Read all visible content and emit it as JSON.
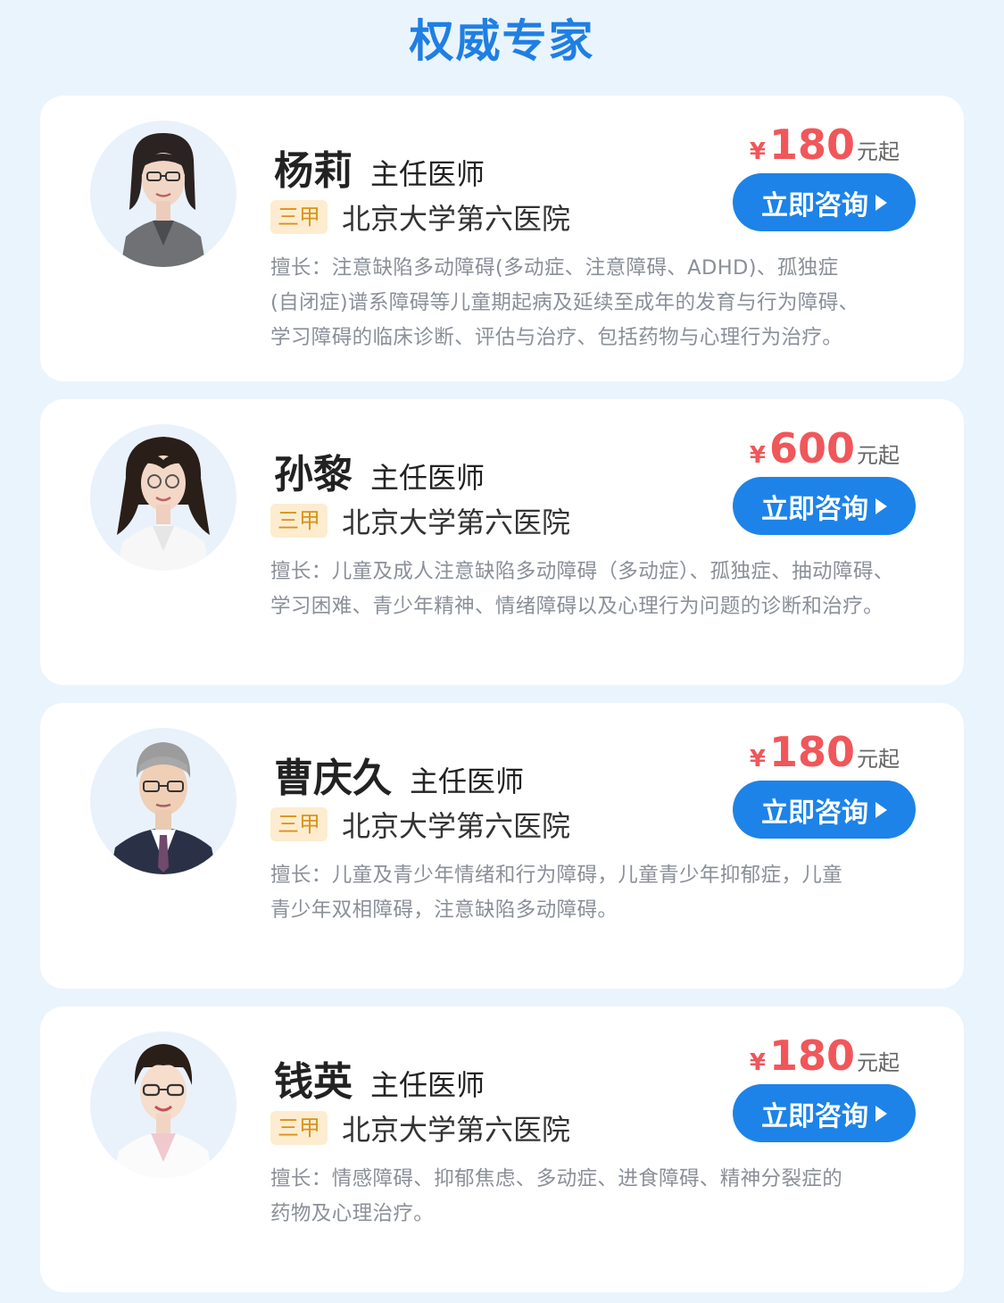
{
  "page_title": "权威专家",
  "experts": [
    {
      "name": "杨莉",
      "title": "主任医师",
      "badge": "三甲",
      "hospital": "北京大学第六医院",
      "price_currency": "¥",
      "price_value": "180",
      "price_suffix": "元起",
      "button_label": "立即咨询",
      "desc_lines": [
        "擅长：注意缺陷多动障碍(多动症、注意障碍、ADHD)、孤独症",
        "(自闭症)谱系障碍等儿童期起病及延续至成年的发育与行为障碍、",
        "学习障碍的临床诊断、评估与治疗、包括药物与心理行为治疗。"
      ]
    },
    {
      "name": "孙黎",
      "title": "主任医师",
      "badge": "三甲",
      "hospital": "北京大学第六医院",
      "price_currency": "¥",
      "price_value": "600",
      "price_suffix": "元起",
      "button_label": "立即咨询",
      "desc_lines": [
        "擅长：儿童及成人注意缺陷多动障碍（多动症）、孤独症、抽动障碍、",
        "学习困难、青少年精神、情绪障碍以及心理行为问题的诊断和治疗。"
      ]
    },
    {
      "name": "曹庆久",
      "title": "主任医师",
      "badge": "三甲",
      "hospital": "北京大学第六医院",
      "price_currency": "¥",
      "price_value": "180",
      "price_suffix": "元起",
      "button_label": "立即咨询",
      "desc_lines": [
        "擅长：儿童及青少年情绪和行为障碍，儿童青少年抑郁症，儿童",
        "青少年双相障碍，注意缺陷多动障碍。"
      ]
    },
    {
      "name": "钱英",
      "title": "主任医师",
      "badge": "三甲",
      "hospital": "北京大学第六医院",
      "price_currency": "¥",
      "price_value": "180",
      "price_suffix": "元起",
      "button_label": "立即咨询",
      "desc_lines": [
        "擅长：情感障碍、抑郁焦虑、多动症、进食障碍、精神分裂症的",
        "药物及心理治疗。"
      ]
    }
  ],
  "colors": {
    "title_blue": "#1f7fe3",
    "button_blue": "#1d83e8",
    "price_red": "#f0575a",
    "badge_bg": "#fdeccf",
    "badge_text": "#d8931b",
    "page_bg": "#eaf4fd"
  }
}
